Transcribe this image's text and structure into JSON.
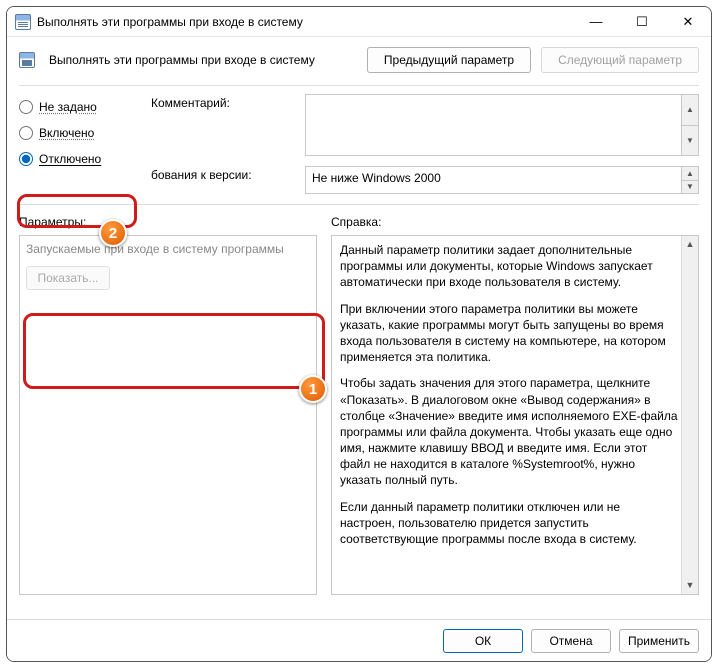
{
  "window": {
    "title": "Выполнять эти программы при входе в систему"
  },
  "header": {
    "policy_title": "Выполнять эти программы при входе в систему",
    "prev_btn": "Предыдущий параметр",
    "next_btn": "Следующий параметр"
  },
  "radios": {
    "not_configured": "Не задано",
    "enabled": "Включено",
    "disabled": "Отключено"
  },
  "fields": {
    "comment_label": "Комментарий:",
    "version_label": "бования к версии:",
    "version_value": "Не ниже Windows 2000"
  },
  "params": {
    "section_label": "Параметры:",
    "inner_title": "Запускаемые при входе в систему программы",
    "show_btn": "Показать..."
  },
  "help": {
    "section_label": "Справка:",
    "p1": "Данный параметр политики задает дополнительные программы или документы, которые Windows запускает автоматически при входе пользователя в систему.",
    "p2": "При включении этого параметра политики вы можете указать, какие программы могут быть запущены во время входа пользователя в систему на компьютере, на котором применяется эта политика.",
    "p3": "Чтобы задать значения для этого параметра, щелкните «Показать». В диалоговом окне «Вывод содержания» в столбце «Значение» введите имя исполняемого EXE-файла программы или файла документа. Чтобы указать еще одно имя, нажмите клавишу ВВОД и введите имя. Если этот файл не находится в каталоге %Systemroot%, нужно указать полный путь.",
    "p4": "Если данный параметр политики отключен или не настроен, пользователю придется запустить соответствующие программы после входа в систему."
  },
  "footer": {
    "ok": "ОК",
    "cancel": "Отмена",
    "apply": "Применить"
  },
  "badges": {
    "one": "1",
    "two": "2"
  }
}
